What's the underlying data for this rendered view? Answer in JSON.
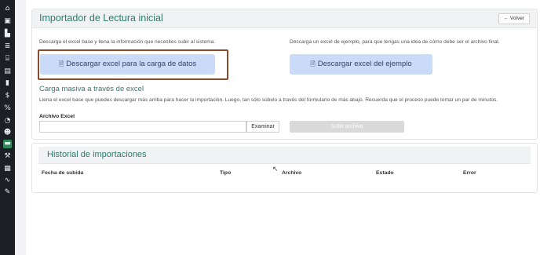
{
  "sidebar": {
    "icons": [
      "home-icon",
      "money-icon",
      "chart-icon",
      "list-icon",
      "bank-icon",
      "document-icon",
      "book-icon",
      "dollar-icon",
      "percent-icon",
      "gauge-icon",
      "users-icon",
      "folder-icon",
      "wrench-icon",
      "calculator-icon",
      "line-chart-icon",
      "tools-icon"
    ]
  },
  "importer": {
    "title": "Importador de Lectura inicial",
    "back_label": "Volver",
    "base_desc": "Descarga el excel base y llena la información que necesites subir al sistema.",
    "base_button": "Descargar excel para la carga de datos",
    "example_desc": "Descarga un excel de ejemplo, para que tengas una idea de cómo debe ser el archivo final.",
    "example_button": "Descargar excel del ejemplo",
    "bulk_title": "Carga masiva a través de excel",
    "bulk_desc": "Llena el excel base que puedes descargar más arriba para hacer la importación. Luego, tan sólo súbelo a través del formulario de más abajo. Recuerda que el proceso puede tomar un par de minutos.",
    "file_label": "Archivo Excel",
    "browse_label": "Examinar",
    "upload_label": "Subir archivo"
  },
  "history": {
    "title": "Historial de importaciones",
    "columns": [
      "Fecha de subida",
      "Tipo",
      "Archivo",
      "Estado",
      "Error"
    ]
  }
}
